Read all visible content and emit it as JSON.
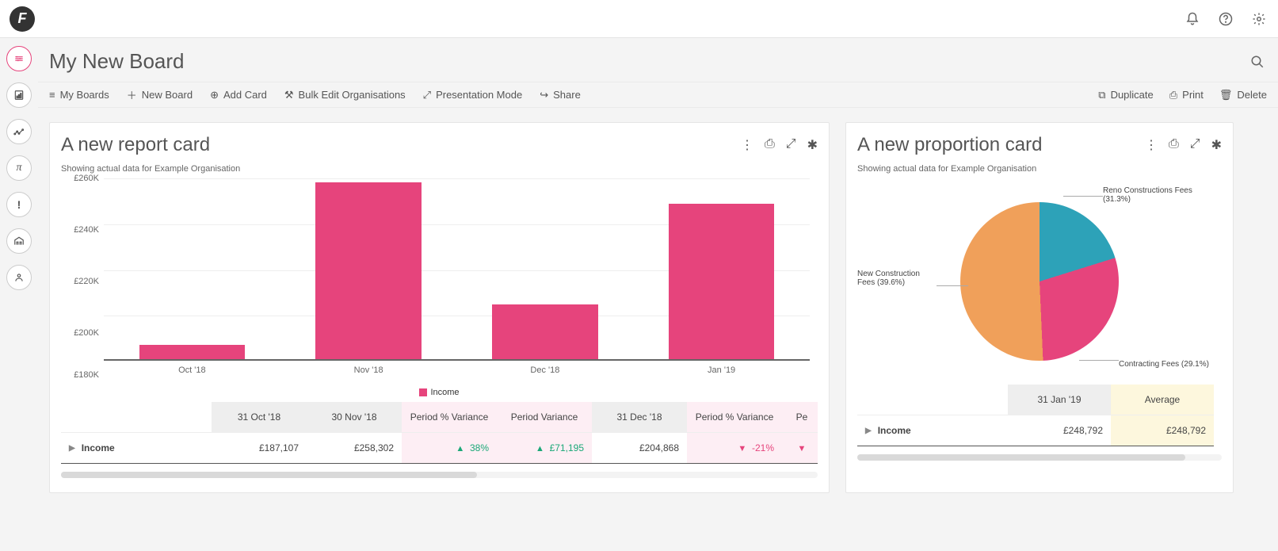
{
  "page": {
    "title": "My New Board"
  },
  "toolbar": {
    "myBoards": "My Boards",
    "newBoard": "New Board",
    "addCard": "Add Card",
    "bulkEdit": "Bulk Edit Organisations",
    "presentation": "Presentation Mode",
    "share": "Share",
    "duplicate": "Duplicate",
    "print": "Print",
    "delete": "Delete"
  },
  "card1": {
    "title": "A new report card",
    "subtitle": "Showing actual data for Example Organisation",
    "legend": "Income",
    "row_label": "Income",
    "headers": [
      "31 Oct '18",
      "30 Nov '18",
      "Period % Variance",
      "Period Variance",
      "31 Dec '18",
      "Period % Variance",
      "Pe"
    ],
    "values": [
      "£187,107",
      "£258,302",
      "38%",
      "£71,195",
      "£204,868",
      "-21%",
      ""
    ],
    "variance_dir": [
      "",
      "",
      "up",
      "up",
      "",
      "down",
      "down"
    ]
  },
  "card2": {
    "title": "A new proportion card",
    "subtitle": "Showing actual data for Example Organisation",
    "labels": {
      "reno": "Reno Constructions Fees (31.3%)",
      "contracting": "Contracting Fees (29.1%)",
      "newcon": "New Construction Fees (39.6%)"
    },
    "row_label": "Income",
    "headers": [
      "31 Jan '19",
      "Average"
    ],
    "values": [
      "£248,792",
      "£248,792"
    ]
  },
  "chart_data": [
    {
      "type": "bar",
      "title": "A new report card",
      "categories": [
        "Oct '18",
        "Nov '18",
        "Dec '18",
        "Jan '19"
      ],
      "series": [
        {
          "name": "Income",
          "values": [
            187107,
            258302,
            204868,
            248792
          ]
        }
      ],
      "ylabel": "",
      "xlabel": "",
      "ylim": [
        180000,
        260000
      ],
      "yticks_labels": [
        "£180K",
        "£200K",
        "£220K",
        "£240K",
        "£260K"
      ]
    },
    {
      "type": "pie",
      "title": "A new proportion card",
      "series": [
        {
          "name": "Reno Constructions Fees",
          "value": 31.3,
          "color": "#2da2b8"
        },
        {
          "name": "Contracting Fees",
          "value": 29.1,
          "color": "#e6447c"
        },
        {
          "name": "New Construction Fees",
          "value": 39.6,
          "color": "#f0a05a"
        }
      ]
    }
  ]
}
